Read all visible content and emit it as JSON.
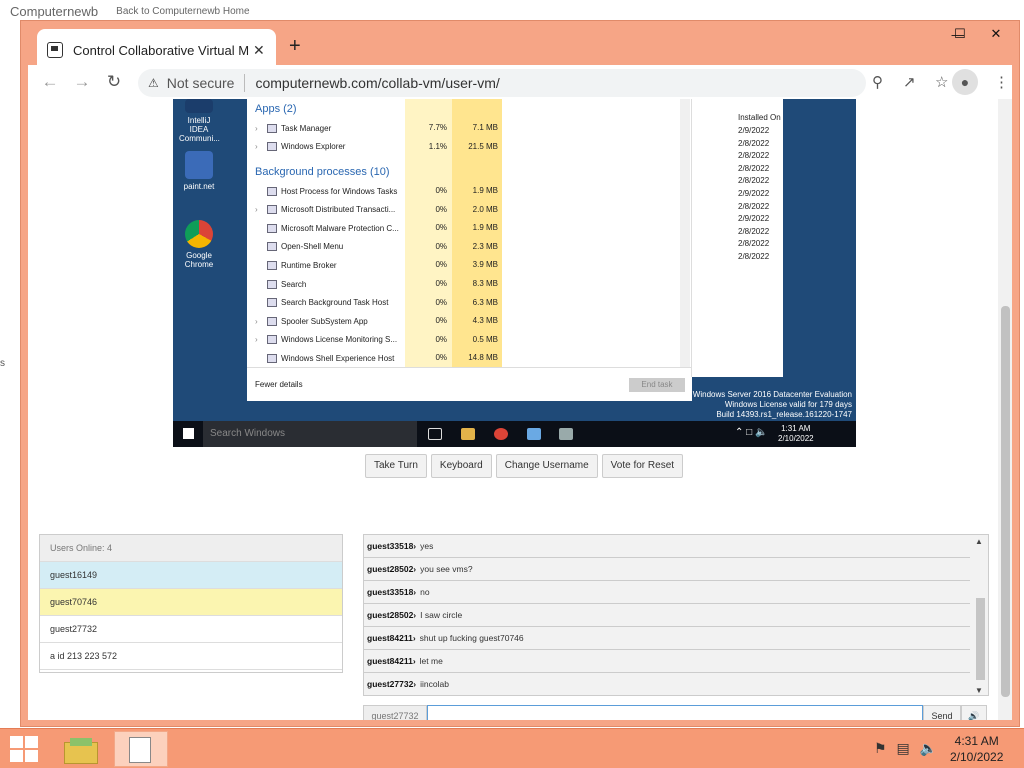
{
  "background_page": {
    "brand": "Computernewb",
    "back_link": "Back to Computernewb Home",
    "side_text": "s"
  },
  "browser": {
    "tab_title": "Control Collaborative Virtual Ma",
    "close_tab": "✕",
    "new_tab": "+",
    "window_controls": {
      "minimize": "—",
      "maximize": "☐",
      "close": "✕"
    },
    "nav": {
      "back": "←",
      "forward": "→",
      "reload": "↻"
    },
    "security_icon": "⚠",
    "security_text": "Not secure",
    "url": "computernewb.com/collab-vm/user-vm/"
  },
  "vm": {
    "desktop_icons": [
      {
        "label": "IntelliJ IDEA Communi...",
        "color": "#1b3d6b"
      },
      {
        "label": "paint.net",
        "color": "#3b6bb8"
      },
      {
        "label": "Google Chrome",
        "color": "#e0a020"
      }
    ],
    "task_manager": {
      "apps_header": "Apps (2)",
      "apps": [
        {
          "name": "Task Manager",
          "cpu": "7.7%",
          "mem": "7.1 MB"
        },
        {
          "name": "Windows Explorer",
          "cpu": "1.1%",
          "mem": "21.5 MB"
        }
      ],
      "bg_header": "Background processes (10)",
      "bg": [
        {
          "name": "Host Process for Windows Tasks",
          "cpu": "0%",
          "mem": "1.9 MB"
        },
        {
          "name": "Microsoft Distributed Transacti...",
          "cpu": "0%",
          "mem": "2.0 MB"
        },
        {
          "name": "Microsoft Malware Protection C...",
          "cpu": "0%",
          "mem": "1.9 MB"
        },
        {
          "name": "Open-Shell Menu",
          "cpu": "0%",
          "mem": "2.3 MB"
        },
        {
          "name": "Runtime Broker",
          "cpu": "0%",
          "mem": "3.9 MB"
        },
        {
          "name": "Search",
          "cpu": "0%",
          "mem": "8.3 MB"
        },
        {
          "name": "Search Background Task Host",
          "cpu": "0%",
          "mem": "6.3 MB"
        },
        {
          "name": "Spooler SubSystem App",
          "cpu": "0%",
          "mem": "4.3 MB"
        },
        {
          "name": "Windows License Monitoring S...",
          "cpu": "0%",
          "mem": "0.5 MB"
        },
        {
          "name": "Windows Shell Experience Host",
          "cpu": "0%",
          "mem": "14.8 MB"
        }
      ],
      "fewer_details": "Fewer details",
      "end_task": "End task"
    },
    "installed": {
      "header": "Installed On",
      "dates": [
        "2/9/2022",
        "2/8/2022",
        "2/8/2022",
        "2/8/2022",
        "2/8/2022",
        "2/9/2022",
        "2/8/2022",
        "2/9/2022",
        "2/8/2022",
        "2/8/2022",
        "2/8/2022"
      ]
    },
    "watermark": [
      "Windows Server 2016 Datacenter Evaluation",
      "Windows License valid for 179 days",
      "Build 14393.rs1_release.161220-1747"
    ],
    "taskbar": {
      "search": "Search Windows",
      "time": "1:31 AM",
      "date": "2/10/2022"
    }
  },
  "controls": {
    "take_turn": "Take Turn",
    "keyboard": "Keyboard",
    "change_username": "Change Username",
    "vote_reset": "Vote for Reset"
  },
  "users": {
    "header": "Users Online: 4",
    "list": [
      {
        "name": "guest16149",
        "color": "#d4edf5"
      },
      {
        "name": "guest70746",
        "color": "#fbf5b0"
      },
      {
        "name": "guest27732",
        "color": "#ffffff"
      },
      {
        "name": "a id 213 223 572",
        "color": "#ffffff"
      }
    ]
  },
  "chat": {
    "messages": [
      {
        "user": "guest33518›",
        "text": "yes"
      },
      {
        "user": "guest28502›",
        "text": "you see vms?"
      },
      {
        "user": "guest33518›",
        "text": "no"
      },
      {
        "user": "guest28502›",
        "text": "I saw circle"
      },
      {
        "user": "guest84211›",
        "text": "shut up fucking guest70746"
      },
      {
        "user": "guest84211›",
        "text": "let me"
      },
      {
        "user": "guest27732›",
        "text": "iincolab"
      }
    ],
    "username": "guest27732",
    "input_value": "",
    "send": "Send",
    "speaker": "🔊"
  },
  "host_taskbar": {
    "time": "4:31 AM",
    "date": "2/10/2022"
  }
}
